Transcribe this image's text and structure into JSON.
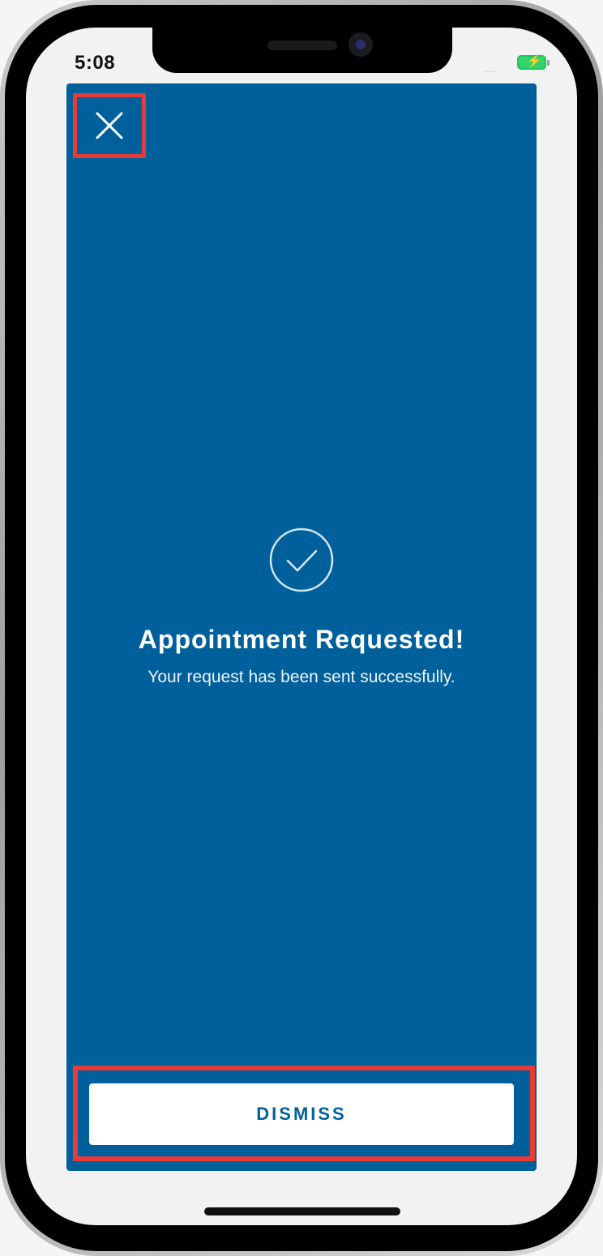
{
  "status_bar": {
    "time": "5:08",
    "signal": "....",
    "battery_icon": "battery-charging-icon"
  },
  "modal": {
    "close_icon": "close-icon",
    "check_icon": "check-circle-icon",
    "title": "Appointment Requested!",
    "subtitle": "Your request has been sent successfully.",
    "dismiss_label": "DISMISS",
    "background_color": "#00609c",
    "highlight_color": "#e63b36"
  }
}
